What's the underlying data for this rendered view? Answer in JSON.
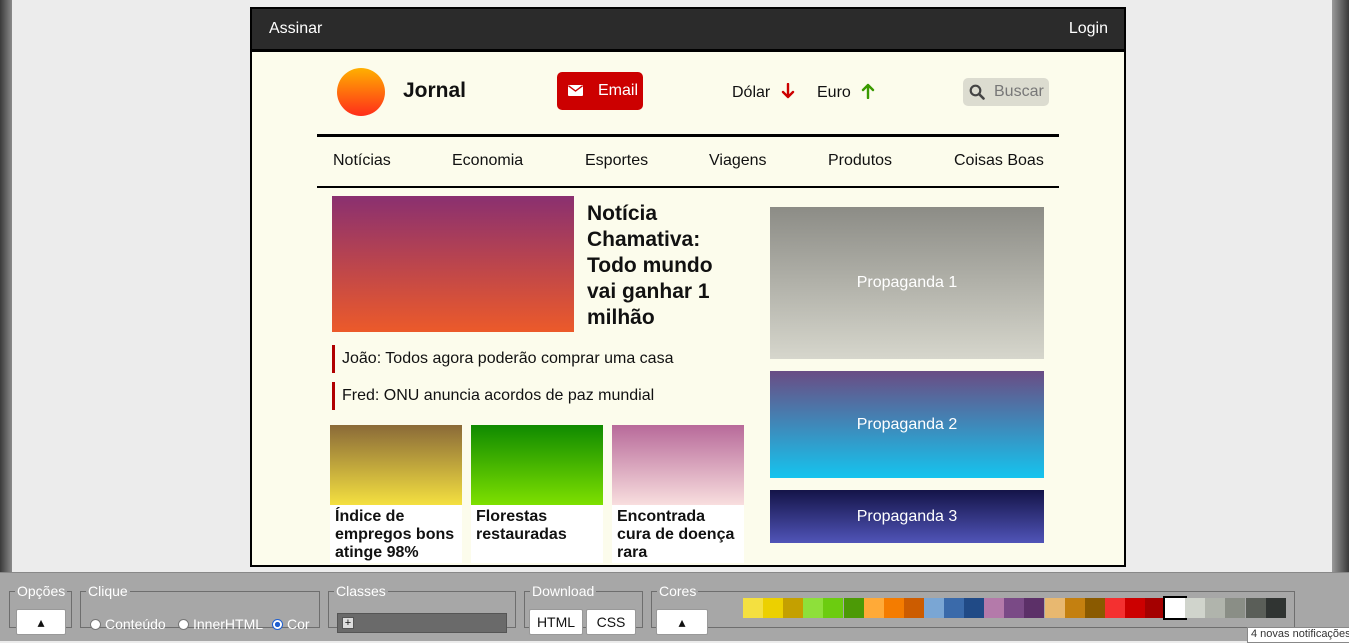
{
  "topbar": {
    "subscribe": "Assinar",
    "login": "Login"
  },
  "brand": {
    "name": "Jornal"
  },
  "email": {
    "label": "Email"
  },
  "currencies": [
    {
      "name": "Dólar",
      "trend": "down",
      "color": "#cc0000"
    },
    {
      "name": "Euro",
      "trend": "up",
      "color": "#3a9a00"
    }
  ],
  "search": {
    "placeholder": "Buscar"
  },
  "nav": [
    "Notícias",
    "Economia",
    "Esportes",
    "Viagens",
    "Produtos",
    "Coisas Boas"
  ],
  "hero": {
    "title": "Notícia Chamativa: Todo mundo vai ganhar 1 milhão"
  },
  "headlines": [
    "João: Todos agora poderão comprar uma casa",
    "Fred: ONU anuncia acordos de paz mundial"
  ],
  "cards": [
    "Índice de empregos bons atinge 98%",
    "Florestas restauradas",
    "Encontrada cura de doença rara"
  ],
  "ads": [
    "Propaganda 1",
    "Propaganda 2",
    "Propaganda 3"
  ],
  "toolbar": {
    "options": {
      "legend": "Opções",
      "button": "▴"
    },
    "click": {
      "legend": "Clique",
      "options": [
        "Conteúdo",
        "InnerHTML",
        "Cor"
      ],
      "selected": "Cor"
    },
    "classes": {
      "legend": "Classes",
      "add": "+"
    },
    "download": {
      "legend": "Download",
      "html": "HTML",
      "css": "CSS"
    },
    "colors": {
      "legend": "Cores",
      "button": "▴"
    }
  },
  "palette": [
    "#f4e040",
    "#ecd000",
    "#c4a000",
    "#8ee03a",
    "#6ccc10",
    "#4c9a06",
    "#ffaa38",
    "#f47c00",
    "#cc5c00",
    "#7aa6d4",
    "#3a6aaa",
    "#204a86",
    "#b47aaa",
    "#7a4a86",
    "#5c3068",
    "#e8b870",
    "#c48010",
    "#8a5a00",
    "#f43030",
    "#cc0000",
    "#a40000",
    "#ffffff",
    "#d0d4cc",
    "#b0b4ac",
    "#8a8e86",
    "#5a5e58",
    "#303432"
  ],
  "notification": "4 novas notificações"
}
